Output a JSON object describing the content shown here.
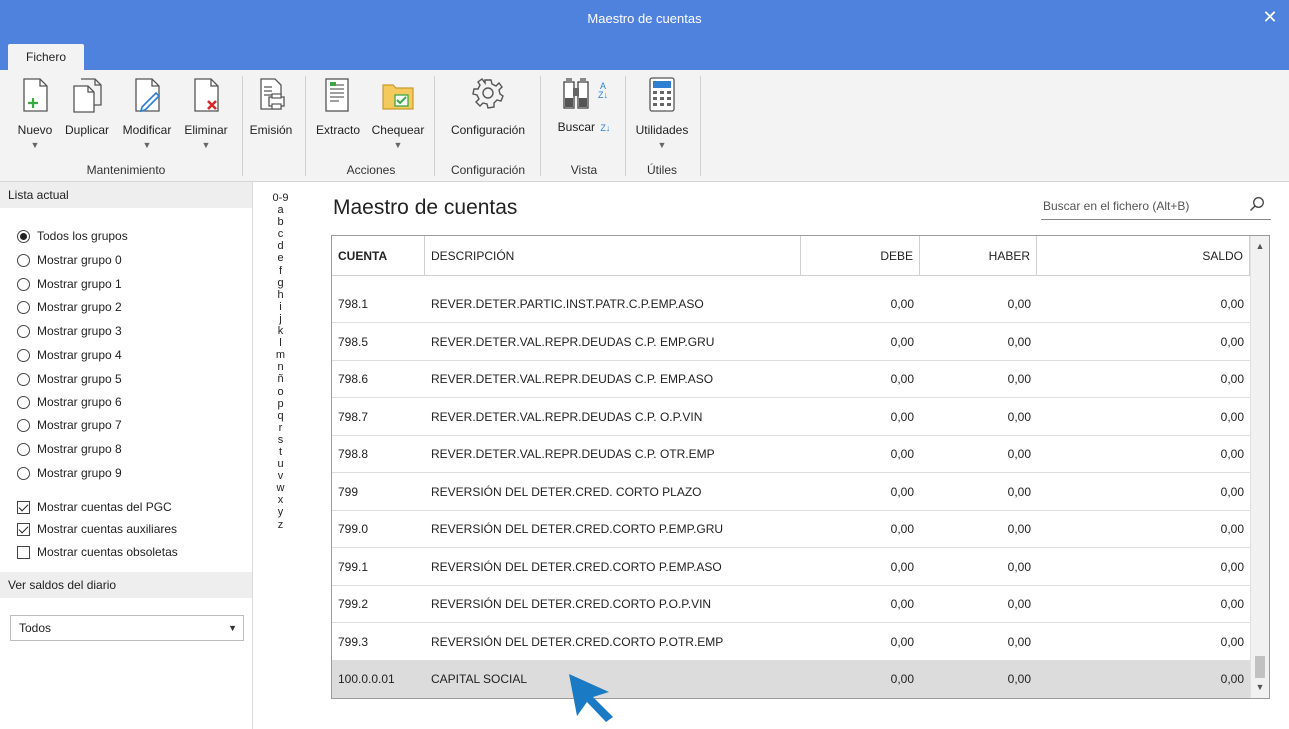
{
  "window": {
    "title": "Maestro de cuentas",
    "close_glyph": "✕"
  },
  "tabs": [
    {
      "label": "Fichero"
    }
  ],
  "ribbon": {
    "buttons": [
      {
        "label": "Nuevo",
        "icon": "new-doc-icon"
      },
      {
        "label": "Duplicar",
        "icon": "duplicate-icon"
      },
      {
        "label": "Modificar",
        "icon": "edit-doc-icon"
      },
      {
        "label": "Eliminar",
        "icon": "delete-doc-icon"
      },
      {
        "label": "Emisión",
        "icon": "print-icon"
      },
      {
        "label": "Extracto",
        "icon": "extract-icon"
      },
      {
        "label": "Chequear",
        "icon": "check-folder-icon"
      },
      {
        "label": "Configuración",
        "icon": "gear-icon"
      },
      {
        "label": "Buscar",
        "icon": "binoculars-icon"
      },
      {
        "label": "Utilidades",
        "icon": "calculator-icon"
      }
    ],
    "groups": [
      {
        "label": "Mantenimiento"
      },
      {
        "label": "Acciones"
      },
      {
        "label": "Configuración"
      },
      {
        "label": "Vista"
      },
      {
        "label": "Útiles"
      }
    ]
  },
  "left_panel": {
    "lista_header": "Lista actual",
    "radios": [
      {
        "label": "Todos los grupos",
        "selected": true
      },
      {
        "label": "Mostrar grupo 0",
        "selected": false
      },
      {
        "label": "Mostrar grupo 1",
        "selected": false
      },
      {
        "label": "Mostrar grupo 2",
        "selected": false
      },
      {
        "label": "Mostrar grupo 3",
        "selected": false
      },
      {
        "label": "Mostrar grupo 4",
        "selected": false
      },
      {
        "label": "Mostrar grupo 5",
        "selected": false
      },
      {
        "label": "Mostrar grupo 6",
        "selected": false
      },
      {
        "label": "Mostrar grupo 7",
        "selected": false
      },
      {
        "label": "Mostrar grupo 8",
        "selected": false
      },
      {
        "label": "Mostrar grupo 9",
        "selected": false
      }
    ],
    "checkboxes": [
      {
        "label": "Mostrar cuentas del PGC",
        "checked": true
      },
      {
        "label": "Mostrar cuentas auxiliares",
        "checked": true
      },
      {
        "label": "Mostrar cuentas obsoletas",
        "checked": false
      }
    ],
    "saldos_header": "Ver saldos del diario",
    "saldos_select": "Todos"
  },
  "alphabet": [
    "0-9",
    "a",
    "b",
    "c",
    "d",
    "e",
    "f",
    "g",
    "h",
    "i",
    "j",
    "k",
    "l",
    "m",
    "n",
    "ñ",
    "o",
    "p",
    "q",
    "r",
    "s",
    "t",
    "u",
    "v",
    "w",
    "x",
    "y",
    "z"
  ],
  "main": {
    "title": "Maestro de cuentas",
    "search_placeholder": "Buscar en el fichero (Alt+B)"
  },
  "table": {
    "columns": [
      "CUENTA",
      "DESCRIPCIÓN",
      "DEBE",
      "HABER",
      "SALDO"
    ],
    "rows": [
      {
        "cuenta": "798.1",
        "descripcion": "REVER.DETER.PARTIC.INST.PATR.C.P.EMP.ASO",
        "debe": "0,00",
        "haber": "0,00",
        "saldo": "0,00"
      },
      {
        "cuenta": "798.5",
        "descripcion": "REVER.DETER.VAL.REPR.DEUDAS C.P. EMP.GRU",
        "debe": "0,00",
        "haber": "0,00",
        "saldo": "0,00"
      },
      {
        "cuenta": "798.6",
        "descripcion": "REVER.DETER.VAL.REPR.DEUDAS C.P. EMP.ASO",
        "debe": "0,00",
        "haber": "0,00",
        "saldo": "0,00"
      },
      {
        "cuenta": "798.7",
        "descripcion": "REVER.DETER.VAL.REPR.DEUDAS C.P. O.P.VIN",
        "debe": "0,00",
        "haber": "0,00",
        "saldo": "0,00"
      },
      {
        "cuenta": "798.8",
        "descripcion": "REVER.DETER.VAL.REPR.DEUDAS C.P. OTR.EMP",
        "debe": "0,00",
        "haber": "0,00",
        "saldo": "0,00"
      },
      {
        "cuenta": "799",
        "descripcion": "REVERSIÓN DEL DETER.CRED. CORTO PLAZO",
        "debe": "0,00",
        "haber": "0,00",
        "saldo": "0,00"
      },
      {
        "cuenta": "799.0",
        "descripcion": "REVERSIÓN DEL DETER.CRED.CORTO P.EMP.GRU",
        "debe": "0,00",
        "haber": "0,00",
        "saldo": "0,00"
      },
      {
        "cuenta": "799.1",
        "descripcion": "REVERSIÓN DEL DETER.CRED.CORTO P.EMP.ASO",
        "debe": "0,00",
        "haber": "0,00",
        "saldo": "0,00"
      },
      {
        "cuenta": "799.2",
        "descripcion": "REVERSIÓN DEL DETER.CRED.CORTO P.O.P.VIN",
        "debe": "0,00",
        "haber": "0,00",
        "saldo": "0,00"
      },
      {
        "cuenta": "799.3",
        "descripcion": "REVERSIÓN DEL DETER.CRED.CORTO P.OTR.EMP",
        "debe": "0,00",
        "haber": "0,00",
        "saldo": "0,00"
      },
      {
        "cuenta": "100.0.0.01",
        "descripcion": "CAPITAL SOCIAL",
        "debe": "0,00",
        "haber": "0,00",
        "saldo": "0,00",
        "selected": true
      }
    ]
  },
  "colors": {
    "titlebar": "#4f82dc",
    "ribbon_bg": "#f3f3f3",
    "accent_icon": "#3aa845",
    "delete_icon": "#d42a2a",
    "cursor": "#1a7bc4",
    "selected_row": "#dcdcdc"
  }
}
